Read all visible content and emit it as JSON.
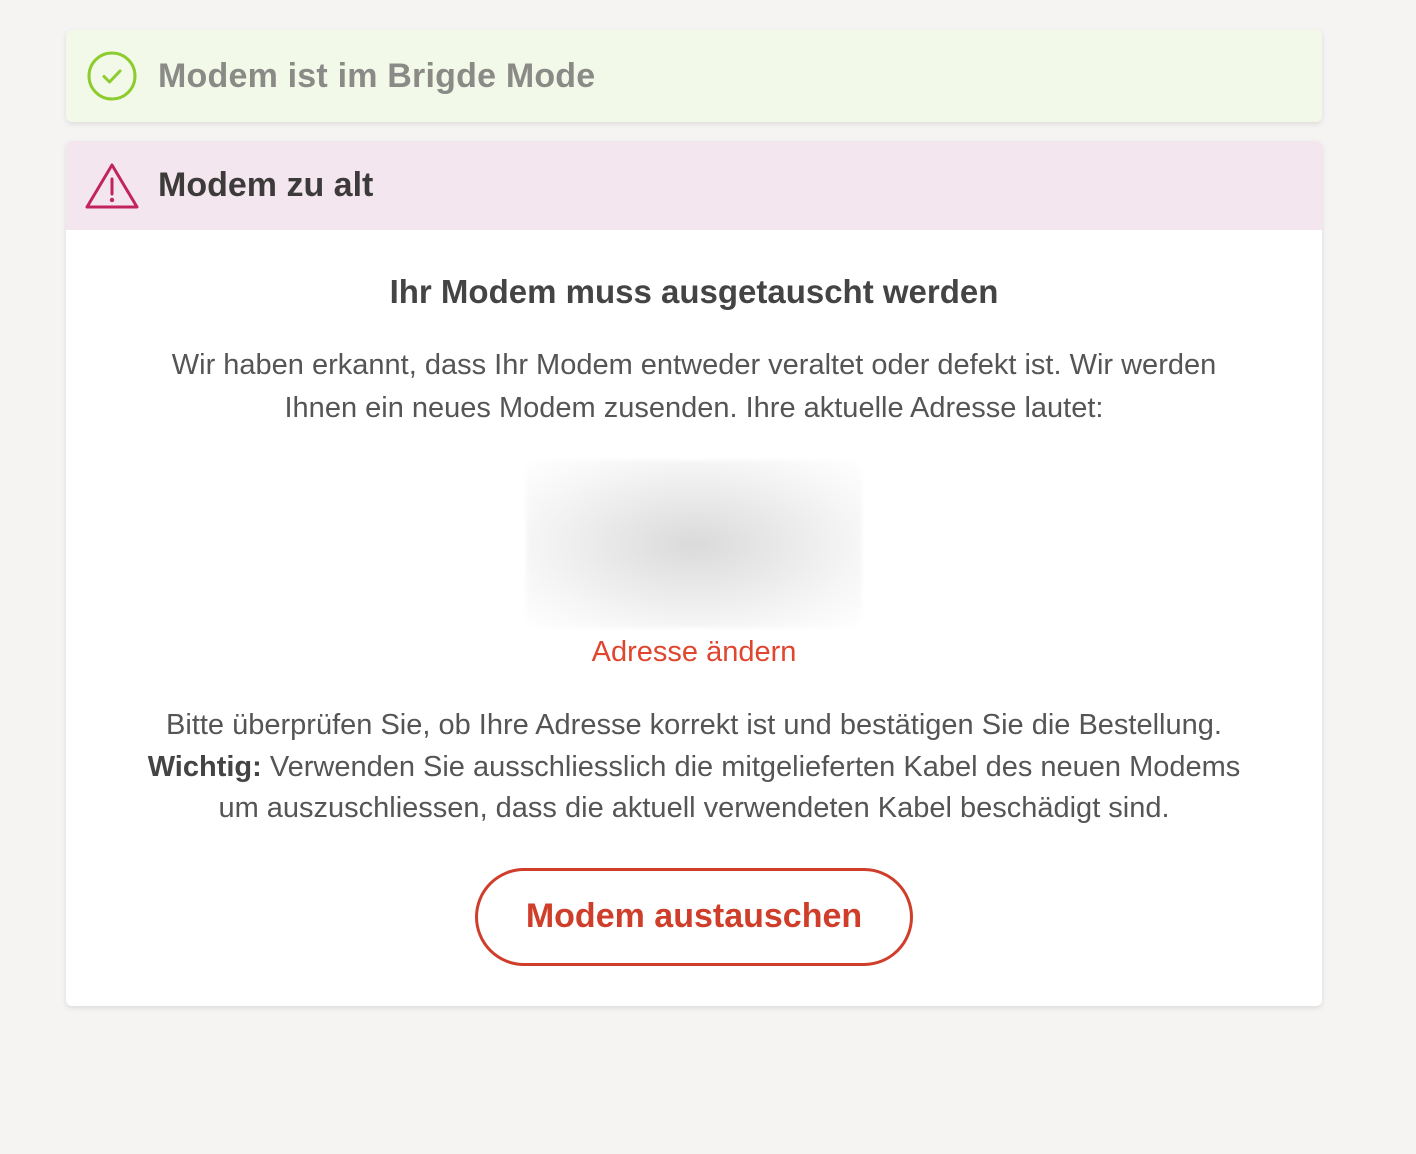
{
  "status_success": {
    "title": "Modem ist im Brigde Mode",
    "icon": "check-circle-icon",
    "color": "#8ccc2e"
  },
  "alert": {
    "title": "Modem zu alt",
    "icon": "warning-triangle-icon",
    "icon_color": "#c2245c",
    "body_title": "Ihr Modem muss ausgetauscht werden",
    "body_text": "Wir haben erkannt, dass Ihr Modem entweder veraltet oder defekt ist. Wir werden Ihnen ein neues Modem zusenden. Ihre aktuelle Adresse lautet:",
    "change_address_label": "Adresse ändern",
    "confirm_text": "Bitte überprüfen Sie, ob Ihre Adresse korrekt ist und bestätigen Sie die Bestellung.",
    "important_label": "Wichtig:",
    "important_text": " Verwenden Sie ausschliesslich die mitgelieferten Kabel des neuen Modems um auszuschliessen, dass die aktuell verwendeten Kabel beschädigt sind.",
    "button_label": "Modem austauschen",
    "accent_color": "#cf3e2a"
  }
}
